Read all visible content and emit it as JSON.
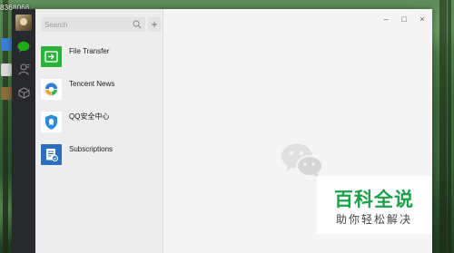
{
  "desktop": {
    "top_left_text": "8368066"
  },
  "app": {
    "nav": {
      "items": [
        {
          "icon": "chat-icon",
          "active": true
        },
        {
          "icon": "contacts-icon",
          "active": false
        },
        {
          "icon": "discover-icon",
          "active": false
        }
      ]
    },
    "search": {
      "placeholder": "Search",
      "add_label": "+"
    },
    "chats": [
      {
        "name": "File Transfer",
        "icon": "file-transfer-icon"
      },
      {
        "name": "Tencent News",
        "icon": "tencent-news-icon"
      },
      {
        "name": "QQ安全中心",
        "icon": "qq-security-icon"
      },
      {
        "name": "Subscriptions",
        "icon": "subscriptions-icon"
      }
    ],
    "window_controls": {
      "minimize": "–",
      "maximize": "□",
      "close": "×"
    }
  },
  "watermark": {
    "title": "百科全说",
    "subtitle": "助你轻松解决"
  },
  "colors": {
    "brand_green": "#1aa24a",
    "nav_background": "#28292c",
    "sidebar_background": "#eeeded",
    "main_background": "#f5f5f5",
    "file_transfer_green": "#2eb03d",
    "subscriptions_blue": "#2c6fbf"
  }
}
